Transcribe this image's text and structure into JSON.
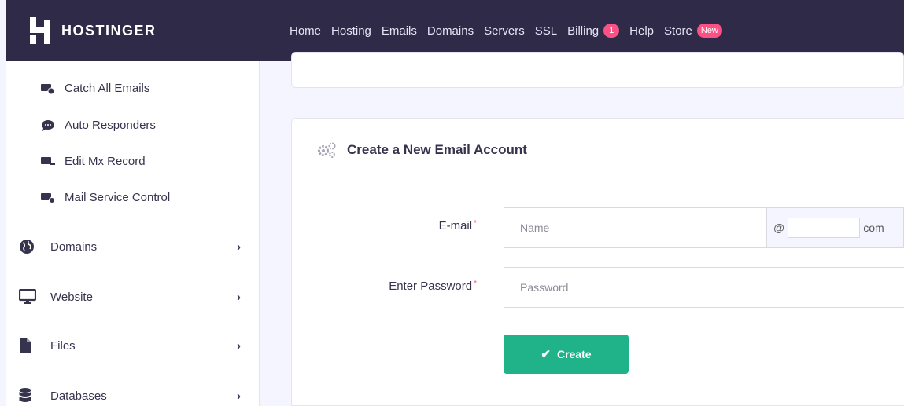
{
  "brand": {
    "name": "HOSTINGER"
  },
  "nav": {
    "items": [
      {
        "label": "Home"
      },
      {
        "label": "Hosting"
      },
      {
        "label": "Emails"
      },
      {
        "label": "Domains"
      },
      {
        "label": "Servers"
      },
      {
        "label": "SSL"
      },
      {
        "label": "Billing",
        "badge": "1"
      },
      {
        "label": "Help"
      },
      {
        "label": "Store",
        "badge": "New"
      }
    ]
  },
  "sidebar": {
    "sub_items": [
      {
        "label": "Catch All Emails",
        "icon": "catch-all-email-icon"
      },
      {
        "label": "Auto Responders",
        "icon": "auto-responder-icon"
      },
      {
        "label": "Edit Mx Record",
        "icon": "mx-record-icon"
      },
      {
        "label": "Mail Service Control",
        "icon": "mail-service-icon"
      }
    ],
    "main_items": [
      {
        "label": "Domains",
        "icon": "globe-icon"
      },
      {
        "label": "Website",
        "icon": "monitor-icon"
      },
      {
        "label": "Files",
        "icon": "file-icon"
      },
      {
        "label": "Databases",
        "icon": "database-icon"
      }
    ]
  },
  "form": {
    "title": "Create a New Email Account",
    "email_label": "E-mail",
    "email_placeholder": "Name",
    "at_sign": "@",
    "domain_suffix": "com",
    "password_label": "Enter Password",
    "password_placeholder": "Password",
    "required_mark": "*",
    "create_label": "Create"
  },
  "colors": {
    "topbar": "#2e2a47",
    "accent_green": "#20b38a",
    "badge_pink": "#fc5185"
  }
}
